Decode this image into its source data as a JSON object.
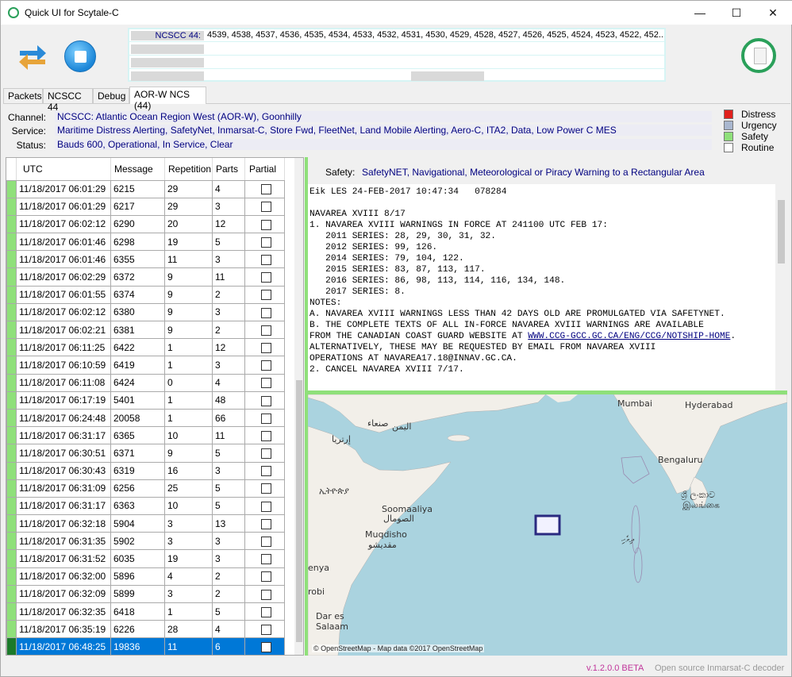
{
  "window": {
    "title": "Quick UI for Scytale-C",
    "minimize": "—",
    "maximize": "☐",
    "close": "✕"
  },
  "icons": {
    "app": "app-circle-icon",
    "swap": "swap-arrows-icon",
    "stop": "stop-icon",
    "document": "document-icon"
  },
  "status_grid": {
    "rows": [
      {
        "key": "NCSCC 44:",
        "value": "4539, 4538, 4537, 4536, 4535, 4534, 4533, 4532, 4531, 4530, 4529, 4528, 4527, 4526, 4525, 4524, 4523, 4522, 452..."
      },
      {
        "key": "",
        "value": ""
      },
      {
        "key": "",
        "value": ""
      },
      {
        "key": "",
        "value": ""
      }
    ]
  },
  "tabs": [
    {
      "label": "Packets"
    },
    {
      "label": "NCSCC 44"
    },
    {
      "label": "Debug"
    },
    {
      "label": "AOR-W NCS (44)",
      "active": true
    }
  ],
  "info": {
    "channel_label": "Channel:",
    "channel": "NCSCC: Atlantic Ocean Region West (AOR-W), Goonhilly",
    "service_label": "Service:",
    "service": "Maritime Distress Alerting, SafetyNet, Inmarsat-C, Store Fwd, FleetNet, Land Mobile Alerting, Aero-C, ITA2, Data, Low Power C MES",
    "status_label": "Status:",
    "status": "Bauds 600, Operational, In Service, Clear"
  },
  "legend": [
    {
      "label": "Distress",
      "color": "#e0201c"
    },
    {
      "label": "Urgency",
      "color": "#a9b7cf"
    },
    {
      "label": "Safety",
      "color": "#8fe07a"
    },
    {
      "label": "Routine",
      "color": "#ffffff"
    }
  ],
  "table": {
    "columns": [
      "UTC",
      "Message",
      "Repetition",
      "Parts",
      "Partial"
    ],
    "rows": [
      [
        "11/18/2017 06:01:29",
        "6215",
        "29",
        "4"
      ],
      [
        "11/18/2017 06:01:29",
        "6217",
        "29",
        "3"
      ],
      [
        "11/18/2017 06:02:12",
        "6290",
        "20",
        "12"
      ],
      [
        "11/18/2017 06:01:46",
        "6298",
        "19",
        "5"
      ],
      [
        "11/18/2017 06:01:46",
        "6355",
        "11",
        "3"
      ],
      [
        "11/18/2017 06:02:29",
        "6372",
        "9",
        "11"
      ],
      [
        "11/18/2017 06:01:55",
        "6374",
        "9",
        "2"
      ],
      [
        "11/18/2017 06:02:12",
        "6380",
        "9",
        "3"
      ],
      [
        "11/18/2017 06:02:21",
        "6381",
        "9",
        "2"
      ],
      [
        "11/18/2017 06:11:25",
        "6422",
        "1",
        "12"
      ],
      [
        "11/18/2017 06:10:59",
        "6419",
        "1",
        "3"
      ],
      [
        "11/18/2017 06:11:08",
        "6424",
        "0",
        "4"
      ],
      [
        "11/18/2017 06:17:19",
        "5401",
        "1",
        "48"
      ],
      [
        "11/18/2017 06:24:48",
        "20058",
        "1",
        "66"
      ],
      [
        "11/18/2017 06:31:17",
        "6365",
        "10",
        "11"
      ],
      [
        "11/18/2017 06:30:51",
        "6371",
        "9",
        "5"
      ],
      [
        "11/18/2017 06:30:43",
        "6319",
        "16",
        "3"
      ],
      [
        "11/18/2017 06:31:09",
        "6256",
        "25",
        "5"
      ],
      [
        "11/18/2017 06:31:17",
        "6363",
        "10",
        "5"
      ],
      [
        "11/18/2017 06:32:18",
        "5904",
        "3",
        "13"
      ],
      [
        "11/18/2017 06:31:35",
        "5902",
        "3",
        "3"
      ],
      [
        "11/18/2017 06:31:52",
        "6035",
        "19",
        "3"
      ],
      [
        "11/18/2017 06:32:00",
        "5896",
        "4",
        "2"
      ],
      [
        "11/18/2017 06:32:09",
        "5899",
        "3",
        "2"
      ],
      [
        "11/18/2017 06:32:35",
        "6418",
        "1",
        "5"
      ],
      [
        "11/18/2017 06:35:19",
        "6226",
        "28",
        "4"
      ],
      [
        "11/18/2017 06:48:25",
        "19836",
        "11",
        "6"
      ]
    ],
    "selected_index": 26
  },
  "message": {
    "priority_label": "Safety:",
    "priority_text": "SafetyNET, Navigational, Meteorological or Piracy Warning to a Rectangular Area",
    "lines_before_link": "Eik LES 24-FEB-2017 10:47:34   078284\n\nNAVAREA XVIII 8/17\n1. NAVAREA XVIII WARNINGS IN FORCE AT 241100 UTC FEB 17:\n   2011 SERIES: 28, 29, 30, 31, 32.\n   2012 SERIES: 99, 126.\n   2014 SERIES: 79, 104, 122.\n   2015 SERIES: 83, 87, 113, 117.\n   2016 SERIES: 86, 98, 113, 114, 116, 134, 148.\n   2017 SERIES: 8.\nNOTES:\nA. NAVAREA XVIII WARNINGS LESS THAN 42 DAYS OLD ARE PROMULGATED VIA SAFETYNET.\nB. THE COMPLETE TEXTS OF ALL IN-FORCE NAVAREA XVIII WARNINGS ARE AVAILABLE\nFROM THE CANADIAN COAST GUARD WEBSITE AT ",
    "link": "WWW.CCG-GCC.GC.CA/ENG/CCG/NOTSHIP-HOME",
    "lines_after_link": ".\nALTERNATIVELY, THESE MAY BE REQUESTED BY EMAIL FROM NAVAREA XVIII\nOPERATIONS AT NAVAREA17.18@INNAV.GC.CA.\n2. CANCEL NAVAREA XVIII 7/17."
  },
  "map": {
    "labels": {
      "mumbai": "Mumbai",
      "hyderabad": "Hyderabad",
      "bengaluru": "Bengaluru",
      "srilanka": "ශ්‍රී ලංකාව",
      "ilankai": "இலங்கை",
      "maldives": "ދިވެހި",
      "sanaa": "صنعاء",
      "yemen": "اليمن",
      "eritrea": "إرتريا",
      "ethiopia": "ኢትዮጵያ",
      "somalia": "Soomaaliya",
      "somalia_ar": "الصومال",
      "mogadishu": "Muqdisho",
      "mogadishu_ar": "مقديشو",
      "kenya": "enya",
      "nairobi": "robi",
      "dar": "Dar es\nSalaam"
    },
    "copyright": "© OpenStreetMap - Map data ©2017 OpenStreetMap",
    "colors": {
      "sea": "#aad3df",
      "land": "#f2efe9",
      "area_fill": "#f2f2ff",
      "area_border": "#2a2a80"
    }
  },
  "footer": {
    "version": "v.1.2.0.0 BETA",
    "tagline": "Open source Inmarsat-C decoder"
  }
}
